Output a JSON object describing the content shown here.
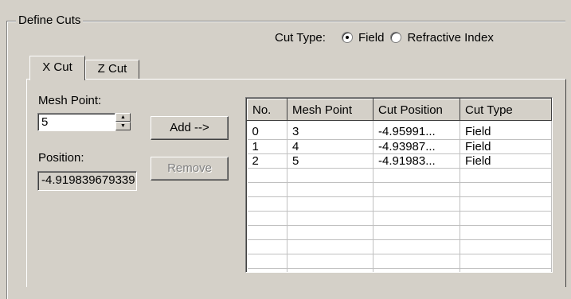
{
  "group": {
    "title": "Define Cuts"
  },
  "cut_type": {
    "label": "Cut Type:",
    "options": [
      {
        "label": "Field",
        "selected": true
      },
      {
        "label": "Refractive Index",
        "selected": false
      }
    ]
  },
  "tabs": [
    {
      "label": "X Cut",
      "active": true
    },
    {
      "label": "Z Cut",
      "active": false
    }
  ],
  "mesh_point": {
    "label": "Mesh Point:",
    "value": "5"
  },
  "position": {
    "label": "Position:",
    "value": "-4.919839679339"
  },
  "buttons": {
    "add": "Add -->",
    "remove": "Remove"
  },
  "table": {
    "columns": [
      "No.",
      "Mesh Point",
      "Cut Position",
      "Cut Type"
    ],
    "rows": [
      [
        "0",
        "3",
        "-4.95991...",
        "Field"
      ],
      [
        "1",
        "4",
        "-4.93987...",
        "Field"
      ],
      [
        "2",
        "5",
        "-4.91983...",
        "Field"
      ]
    ]
  }
}
